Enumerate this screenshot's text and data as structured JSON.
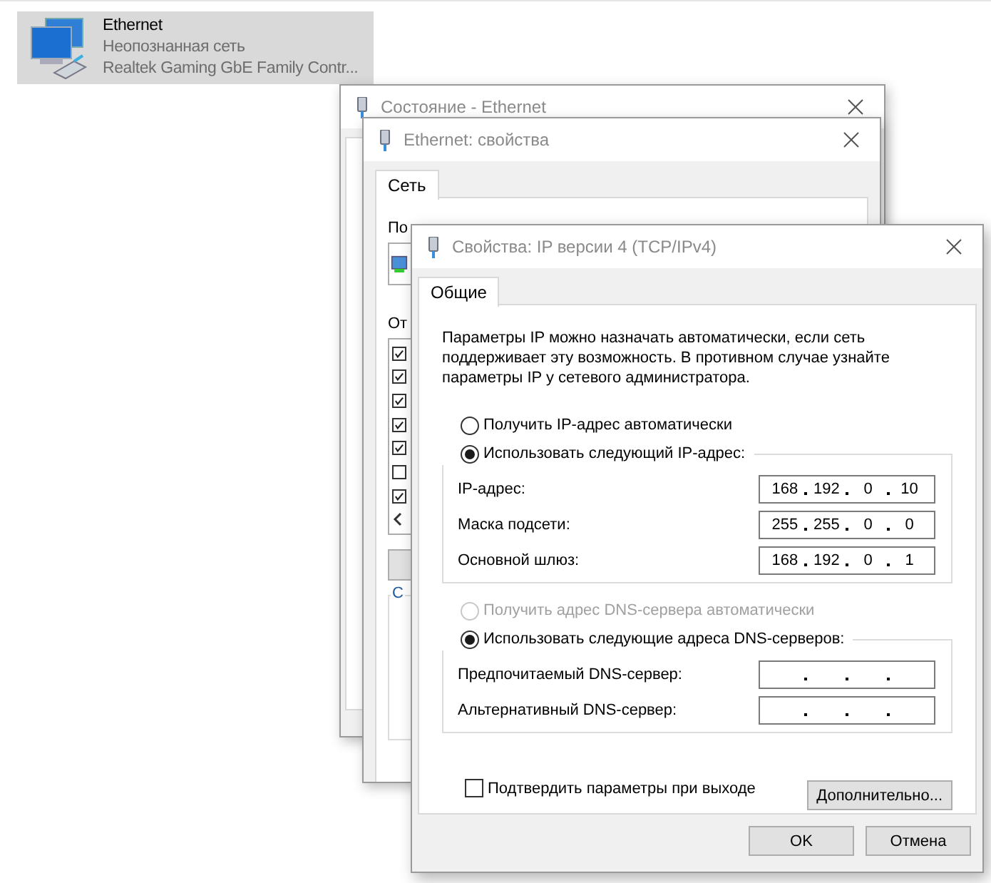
{
  "desktop_item": {
    "title": "Ethernet",
    "subtitle": "Неопознанная сеть",
    "description": "Realtek Gaming GbE Family Contr..."
  },
  "status_window": {
    "title": "Состояние - Ethernet"
  },
  "properties_window": {
    "title": "Ethernet: свойства",
    "tabs": [
      {
        "label": "Сеть",
        "selected": true
      }
    ],
    "connect_label": "По",
    "components_label": "От",
    "group_label": "С",
    "components": [
      {
        "checked": true
      },
      {
        "checked": true
      },
      {
        "checked": true
      },
      {
        "checked": true
      },
      {
        "checked": true
      },
      {
        "checked": false
      },
      {
        "checked": true
      }
    ]
  },
  "ipv4_window": {
    "title": "Свойства: IP версии 4 (TCP/IPv4)",
    "tabs": [
      {
        "label": "Общие",
        "selected": true
      }
    ],
    "description": "Параметры IP можно назначать автоматически, если сеть поддерживает эту возможность. В противном случае узнайте параметры IP у сетевого администратора.",
    "ip_radios": [
      {
        "label": "Получить IP-адрес автоматически",
        "selected": false,
        "disabled": false
      },
      {
        "label": "Использовать следующий IP-адрес:",
        "selected": true,
        "disabled": false
      }
    ],
    "ip_fields": [
      {
        "label": "IP-адрес:",
        "octets": [
          "168",
          "192",
          "0",
          "10"
        ]
      },
      {
        "label": "Маска подсети:",
        "octets": [
          "255",
          "255",
          "0",
          "0"
        ]
      },
      {
        "label": "Основной шлюз:",
        "octets": [
          "168",
          "192",
          "0",
          "1"
        ]
      }
    ],
    "dns_radios": [
      {
        "label": "Получить адрес DNS-сервера автоматически",
        "selected": false,
        "disabled": true
      },
      {
        "label": "Использовать следующие адреса DNS-серверов:",
        "selected": true,
        "disabled": false
      }
    ],
    "dns_fields": [
      {
        "label": "Предпочитаемый DNS-сервер:"
      },
      {
        "label": "Альтернативный DNS-сервер:"
      }
    ],
    "validate_on_exit": {
      "label": "Подтвердить параметры при выходе",
      "checked": false
    },
    "advanced_button": "Дополнительно...",
    "buttons": [
      "OK",
      "Отмена"
    ]
  }
}
